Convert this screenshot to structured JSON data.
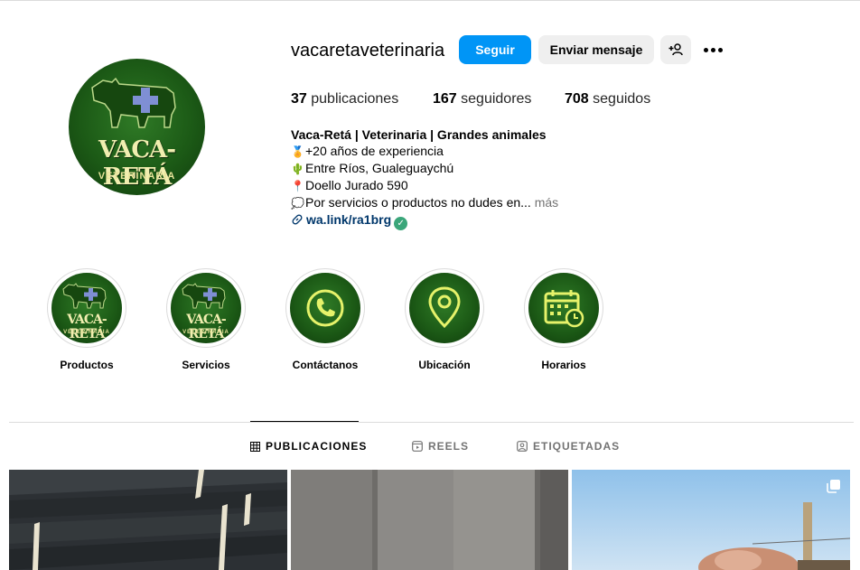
{
  "profile": {
    "username": "vacaretaveterinaria",
    "avatar_brand": "VACA-RETÁ",
    "avatar_sub": "VETERINARIA"
  },
  "actions": {
    "follow_label": "Seguir",
    "message_label": "Enviar mensaje"
  },
  "stats": {
    "posts_count": "37",
    "posts_label": "publicaciones",
    "followers_count": "167",
    "followers_label": "seguidores",
    "following_count": "708",
    "following_label": "seguidos"
  },
  "bio": {
    "name": "Vaca-Retá | Veterinaria | Grandes animales",
    "lines": [
      {
        "icon": "medal-icon",
        "text": "+20 años de experiencia"
      },
      {
        "icon": "cactus-icon",
        "text": "Entre Ríos, Gualeguaychú"
      },
      {
        "icon": "pin-icon",
        "text": "Doello Jurado 590"
      },
      {
        "icon": "speech-bubble-icon",
        "text": "Por servicios o productos no dudes en..."
      }
    ],
    "more_label": "más",
    "link_text": "wa.link/ra1brg"
  },
  "highlights": [
    {
      "label": "Productos",
      "icon": "logo"
    },
    {
      "label": "Servicios",
      "icon": "logo"
    },
    {
      "label": "Contáctanos",
      "icon": "phone-icon"
    },
    {
      "label": "Ubicación",
      "icon": "location-icon"
    },
    {
      "label": "Horarios",
      "icon": "calendar-icon"
    }
  ],
  "highlight_logo_text": "VACA-RETÁ",
  "highlight_logo_sub": "VETERINARIA",
  "tabs": [
    {
      "label": "PUBLICACIONES",
      "icon": "grid-icon",
      "active": true
    },
    {
      "label": "REELS",
      "icon": "reels-icon",
      "active": false
    },
    {
      "label": "ETIQUETADAS",
      "icon": "tagged-icon",
      "active": false
    }
  ],
  "colors": {
    "accent": "#0095f6",
    "brand_green": "#1c5a16",
    "brand_text": "#f1eeb0",
    "link": "#00376b",
    "verified": "#3aa67a"
  }
}
